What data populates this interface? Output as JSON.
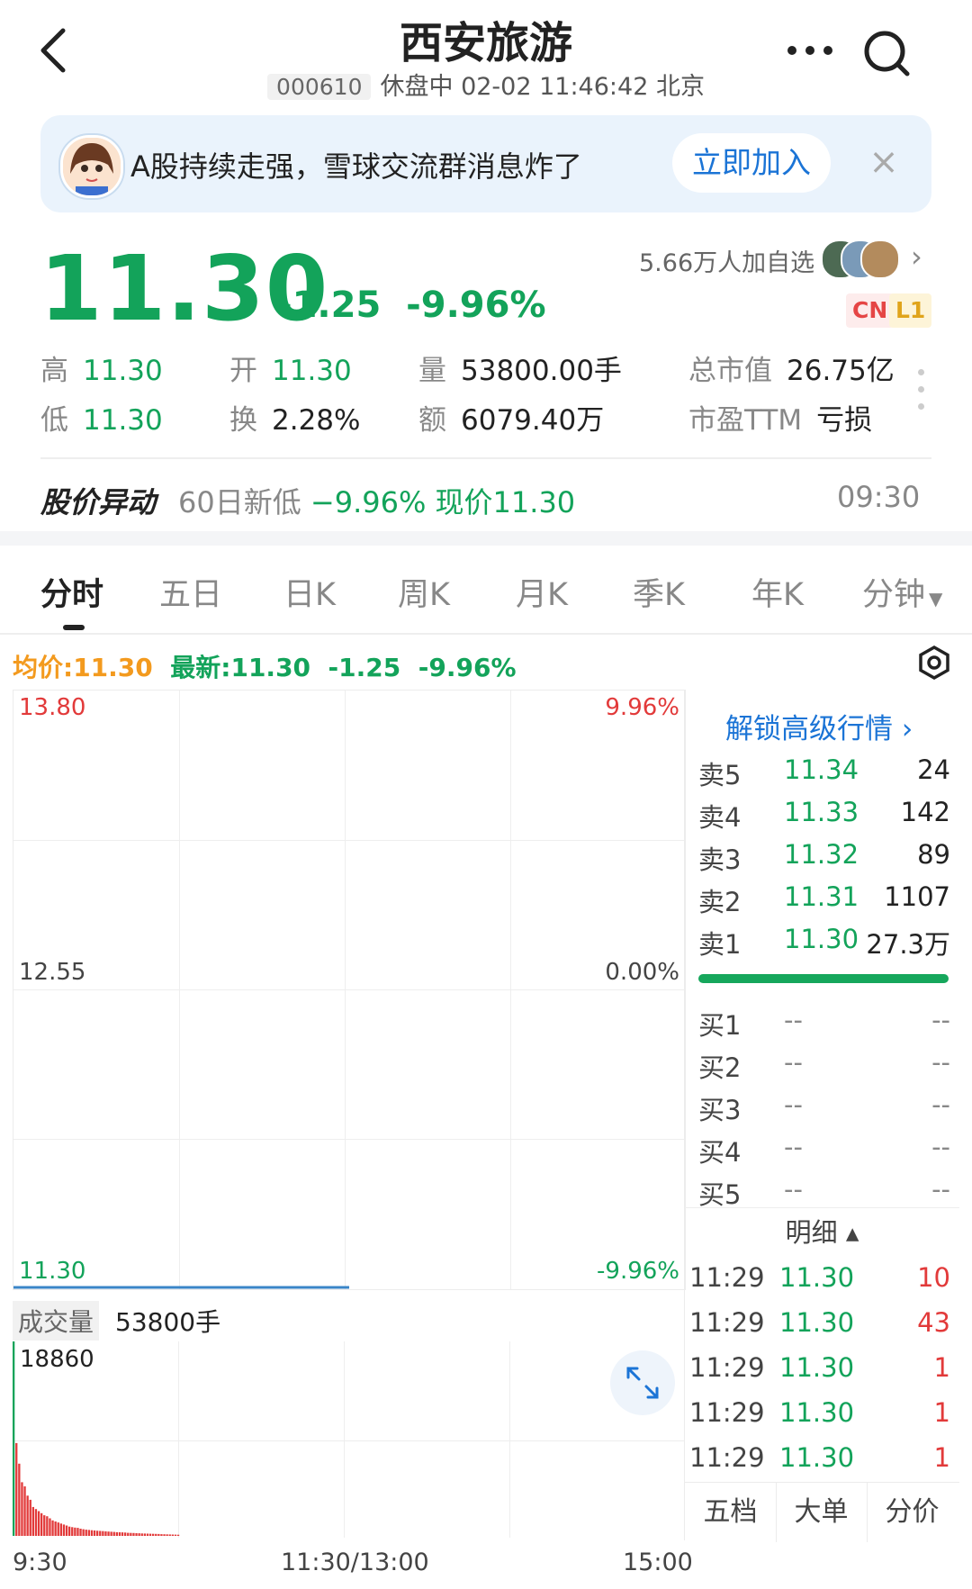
{
  "header": {
    "title": "西安旅游",
    "code": "000610",
    "status_line": "休盘中 02-02 11:46:42 北京"
  },
  "banner": {
    "text": "A股持续走强，雪球交流群消息炸了",
    "join_label": "立即加入",
    "close_label": "×"
  },
  "quote": {
    "price": "11.30",
    "change": "-1.25",
    "change_pct": "-9.96%",
    "followers": "5.66万人加自选",
    "tags": [
      "CN",
      "L1"
    ],
    "stats": [
      {
        "label": "高",
        "value": "11.30",
        "color": "#13a35a"
      },
      {
        "label": "开",
        "value": "11.30",
        "color": "#13a35a"
      },
      {
        "label": "量",
        "value": "53800.00手",
        "color": "#222222"
      },
      {
        "label": "总市值",
        "value": "26.75亿",
        "color": "#222222"
      },
      {
        "label": "低",
        "value": "11.30",
        "color": "#13a35a"
      },
      {
        "label": "换",
        "value": "2.28%",
        "color": "#222222"
      },
      {
        "label": "额",
        "value": "6079.40万",
        "color": "#222222"
      },
      {
        "label": "市盈TTM",
        "value": "亏损",
        "color": "#222222"
      }
    ]
  },
  "alert": {
    "tag": "股价异动",
    "text_prefix": "60日新低",
    "text_highlight": "−9.96% 现价11.30",
    "time": "09:30"
  },
  "tabs": [
    "分时",
    "五日",
    "日K",
    "周K",
    "月K",
    "季K",
    "年K",
    "分钟"
  ],
  "active_tab": "分时",
  "legend": {
    "avg": "均价:11.30",
    "latest": "最新:11.30",
    "chg": "-1.25",
    "pct": "-9.96%"
  },
  "chart_axis": {
    "y_top": "13.80",
    "y_mid": "12.55",
    "y_bot": "11.30",
    "pct_top": "9.96%",
    "pct_mid": "0.00%",
    "pct_bot": "-9.96%",
    "volume_label": "成交量",
    "volume_value": "53800手",
    "volume_max": "18860",
    "x_ticks": [
      "9:30",
      "11:30/13:00",
      "15:00"
    ]
  },
  "chart_data": {
    "type": "line",
    "title": "",
    "xlabel": "",
    "ylabel": "",
    "ylim": [
      11.3,
      13.8
    ],
    "x": [
      "9:30",
      "11:30"
    ],
    "series": [
      {
        "values": [
          11.3,
          11.3
        ]
      }
    ],
    "volume": {
      "ylim": [
        0,
        18860
      ],
      "values": [
        18860,
        9000,
        7000,
        5200,
        4800,
        3900,
        3500,
        2800,
        2600,
        2400,
        2200,
        2000,
        1900,
        1700,
        1500,
        1400,
        1300,
        1200,
        1100,
        1000,
        900,
        850,
        800,
        780,
        700,
        650,
        600,
        580,
        550,
        520,
        500,
        480,
        460,
        440,
        420,
        400,
        380,
        360,
        350,
        340,
        320,
        300,
        290,
        280,
        260,
        250,
        240,
        230,
        220,
        210,
        200,
        190,
        180,
        170,
        160,
        150,
        140,
        130,
        120,
        110
      ]
    }
  },
  "orderbook": {
    "unlock_label": "解锁高级行情",
    "asks": [
      {
        "label": "卖5",
        "price": "11.34",
        "vol": "24"
      },
      {
        "label": "卖4",
        "price": "11.33",
        "vol": "142"
      },
      {
        "label": "卖3",
        "price": "11.32",
        "vol": "89"
      },
      {
        "label": "卖2",
        "price": "11.31",
        "vol": "1107"
      },
      {
        "label": "卖1",
        "price": "11.30",
        "vol": "27.3万"
      }
    ],
    "bids": [
      {
        "label": "买1",
        "price": "--",
        "vol": "--"
      },
      {
        "label": "买2",
        "price": "--",
        "vol": "--"
      },
      {
        "label": "买3",
        "price": "--",
        "vol": "--"
      },
      {
        "label": "买4",
        "price": "--",
        "vol": "--"
      },
      {
        "label": "买5",
        "price": "--",
        "vol": "--"
      }
    ],
    "detail_label": "明细 ▴",
    "trades": [
      {
        "time": "11:29",
        "price": "11.30",
        "qty": "10"
      },
      {
        "time": "11:29",
        "price": "11.30",
        "qty": "43"
      },
      {
        "time": "11:29",
        "price": "11.30",
        "qty": "1"
      },
      {
        "time": "11:29",
        "price": "11.30",
        "qty": "1"
      },
      {
        "time": "11:29",
        "price": "11.30",
        "qty": "1"
      }
    ],
    "bottom_tabs": [
      "五档",
      "大单",
      "分价"
    ]
  },
  "colors": {
    "down": "#13a35a",
    "up": "#e23a3a",
    "avg": "#f39a1e",
    "accent": "#1b74d6"
  }
}
